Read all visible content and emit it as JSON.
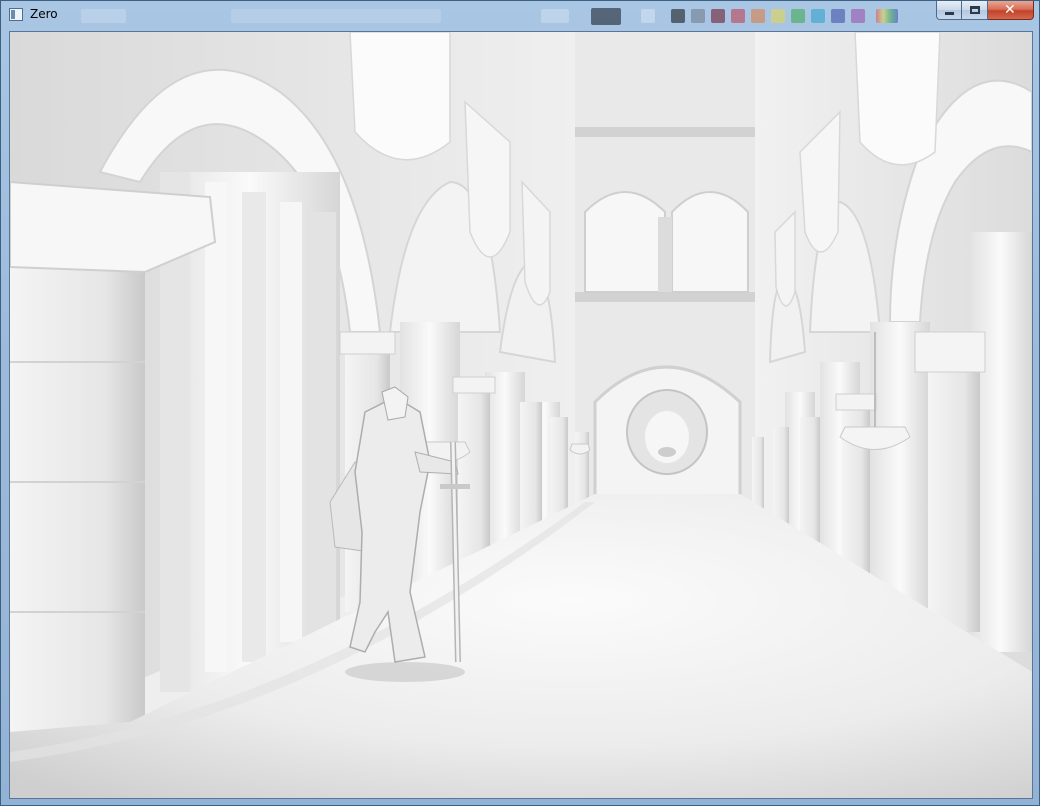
{
  "window": {
    "title": "Zero"
  },
  "icons": {
    "app": "app-window-icon",
    "minimize": "minimize-icon",
    "maximize": "maximize-icon",
    "close": "close-icon"
  },
  "caption": {
    "close_glyph": "✕"
  },
  "colors": {
    "titlebar": "#a9c6e4",
    "close_button": "#c2432a",
    "scene_background": "#f2f2f2"
  }
}
